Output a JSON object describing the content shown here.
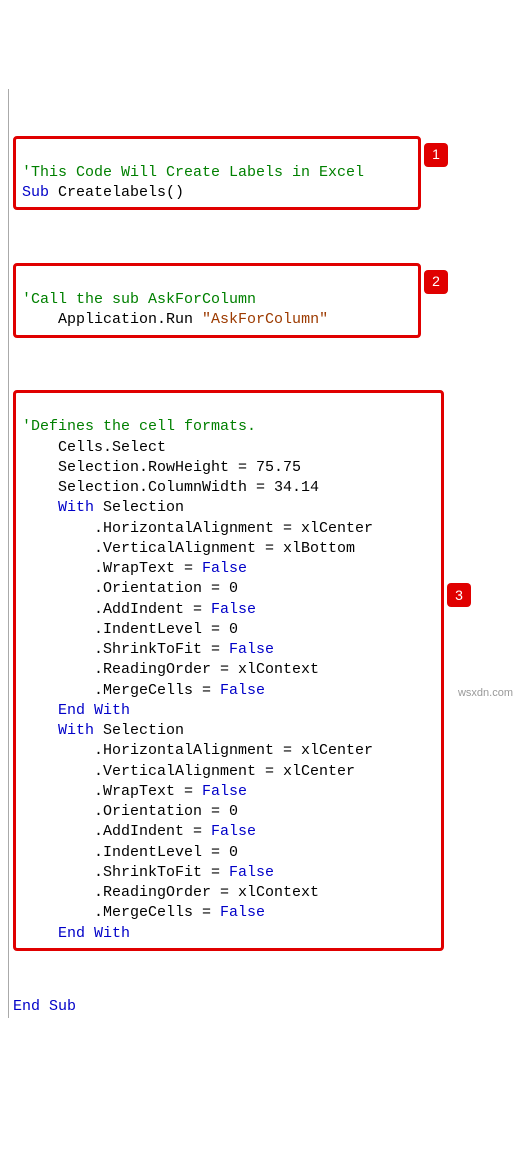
{
  "block1": {
    "badge": "1",
    "comment": "'This Code Will Create Labels in Excel",
    "kw_sub": "Sub",
    "name": " Createlabels()"
  },
  "block2": {
    "badge": "2",
    "comment": "'Call the sub AskForColumn",
    "pad": "    ",
    "run_a": "Application.Run ",
    "run_str": "\"AskForColumn\""
  },
  "block3": {
    "badge": "3",
    "comment": "'Defines the cell formats.",
    "l1": "    Cells.Select",
    "l2": "    Selection.RowHeight = 75.75",
    "l3": "    Selection.ColumnWidth = 34.14",
    "pad4": "    ",
    "pad8": "        ",
    "kw_with": "With",
    "kw_endwith": "End With",
    "sel": " Selection",
    "halign_c": ".HorizontalAlignment = xlCenter",
    "valign_b": ".VerticalAlignment = xlBottom",
    "valign_c": ".VerticalAlignment = xlCenter",
    "wrap_l": ".WrapText = ",
    "false": "False",
    "orient": ".Orientation = 0",
    "addind_l": ".AddIndent = ",
    "indlvl": ".IndentLevel = 0",
    "shrink_l": ".ShrinkToFit = ",
    "rorder": ".ReadingOrder = xlContext",
    "merge_l": ".MergeCells = "
  },
  "footer": {
    "kw_end": "End Sub"
  },
  "watermark": "wsxdn.com"
}
